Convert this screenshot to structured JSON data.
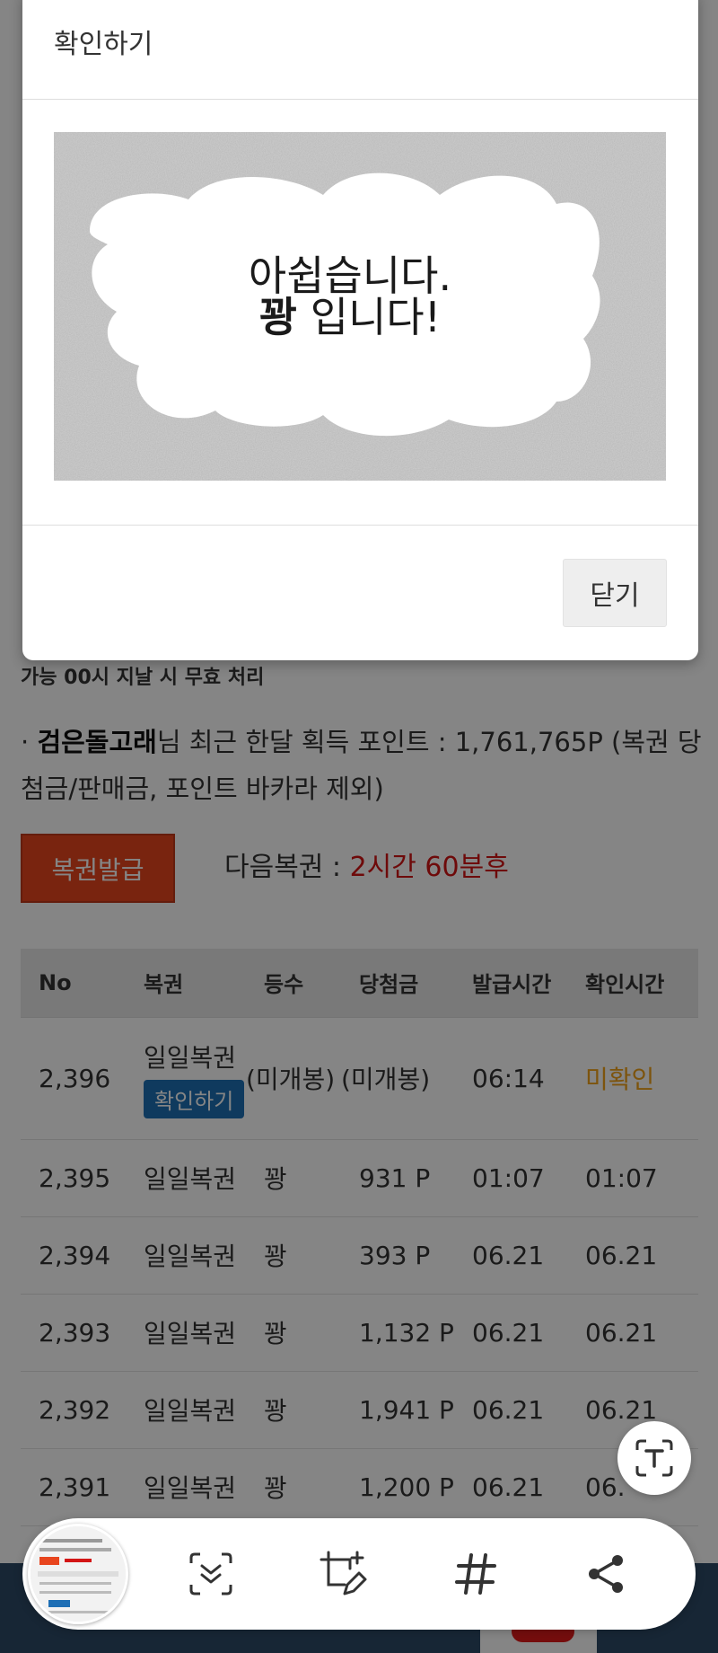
{
  "modal": {
    "title": "확인하기",
    "scratch_line1": "아쉽습니다.",
    "scratch_line2_bold": "꽝",
    "scratch_line2_rest": " 입니다!",
    "close_label": "닫기"
  },
  "notice": "가능 00시 지날 시 무효 처리",
  "points": {
    "bullet": "·",
    "username": "검은돌고래",
    "text": "님 최근 한달 획득 포인트 : 1,761,765P (복권 당첨금/판매금, 포인트 바카라 제외)"
  },
  "issue_button": "복권발급",
  "next_ticket": {
    "label": "다음복권 : ",
    "value": "2시간 60분후"
  },
  "table": {
    "headers": [
      "No",
      "복권",
      "등수",
      "당첨금",
      "발급시간",
      "확인시간"
    ],
    "rows": [
      {
        "no": "2,396",
        "name": "일일복권",
        "badge": "확인하기",
        "rank": "(미개봉)",
        "prize": "(미개봉)",
        "issued": "06:14",
        "checked": "미확인"
      },
      {
        "no": "2,395",
        "name": "일일복권",
        "rank": "꽝",
        "prize": "931 P",
        "issued": "01:07",
        "checked": "01:07"
      },
      {
        "no": "2,394",
        "name": "일일복권",
        "rank": "꽝",
        "prize": "393 P",
        "issued": "06.21",
        "checked": "06.21"
      },
      {
        "no": "2,393",
        "name": "일일복권",
        "rank": "꽝",
        "prize": "1,132 P",
        "issued": "06.21",
        "checked": "06.21"
      },
      {
        "no": "2,392",
        "name": "일일복권",
        "rank": "꽝",
        "prize": "1,941 P",
        "issued": "06.21",
        "checked": "06.21"
      },
      {
        "no": "2,391",
        "name": "일일복권",
        "rank": "꽝",
        "prize": "1,200 P",
        "issued": "06.21",
        "checked": "06."
      }
    ]
  },
  "colors": {
    "issue_button": "#e8451e",
    "next_ticket_value": "#d31515",
    "badge": "#1e6fb5",
    "unconfirmed": "#f0a21a",
    "bottom_bar": "#2c4a66"
  },
  "toolbar": {
    "icons": [
      "screenshot-thumbnail",
      "scroll-capture-icon",
      "draw-crop-icon",
      "hashtag-icon",
      "share-icon"
    ],
    "floating": "extract-text-icon"
  }
}
